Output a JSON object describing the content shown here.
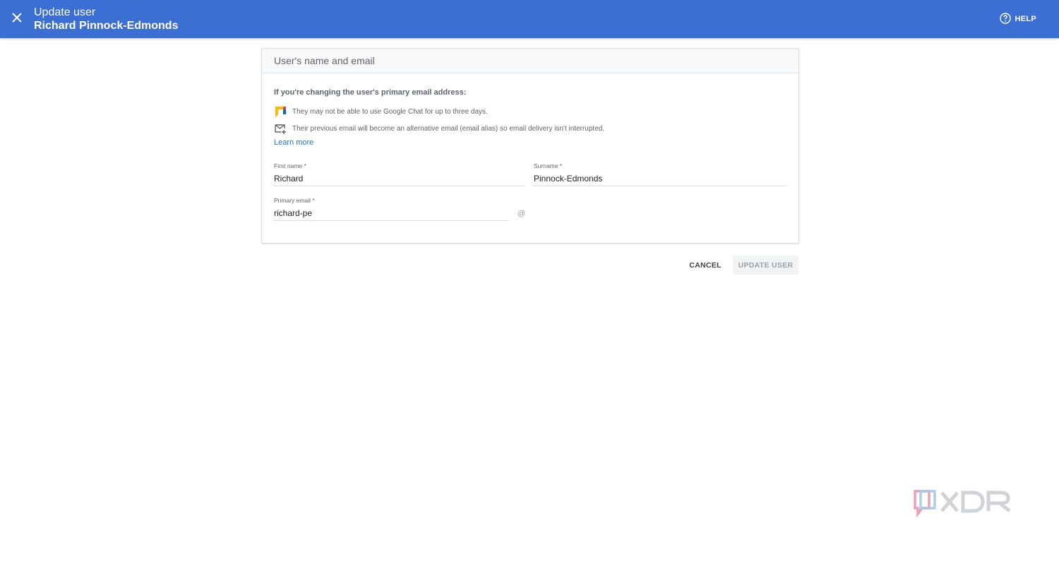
{
  "header": {
    "title": "Update user",
    "subtitle": "Richard Pinnock-Edmonds",
    "help_label": "HELP",
    "close_icon": "close-icon",
    "help_icon": "help-circle-icon",
    "background_color": "#3b6fd4"
  },
  "card": {
    "title": "User's name and email",
    "notice_title": "If you're changing the user's primary email address:",
    "notices": [
      {
        "icon": "google-chat-icon",
        "text": "They may not be able to use Google Chat for up to three days."
      },
      {
        "icon": "mail-add-icon",
        "text": "Their previous email will become an alternative email (email alias) so email delivery isn't interrupted."
      }
    ],
    "learn_more": "Learn more",
    "fields": {
      "first_name": {
        "label": "First name *",
        "value": "Richard"
      },
      "surname": {
        "label": "Surname *",
        "value": "Pinnock-Edmonds"
      },
      "primary_email": {
        "label": "Primary email *",
        "value": "richard-pe",
        "suffix": "@"
      }
    }
  },
  "actions": {
    "cancel_label": "CANCEL",
    "update_label": "UPDATE USER"
  },
  "watermark": {
    "text": "XDA"
  }
}
